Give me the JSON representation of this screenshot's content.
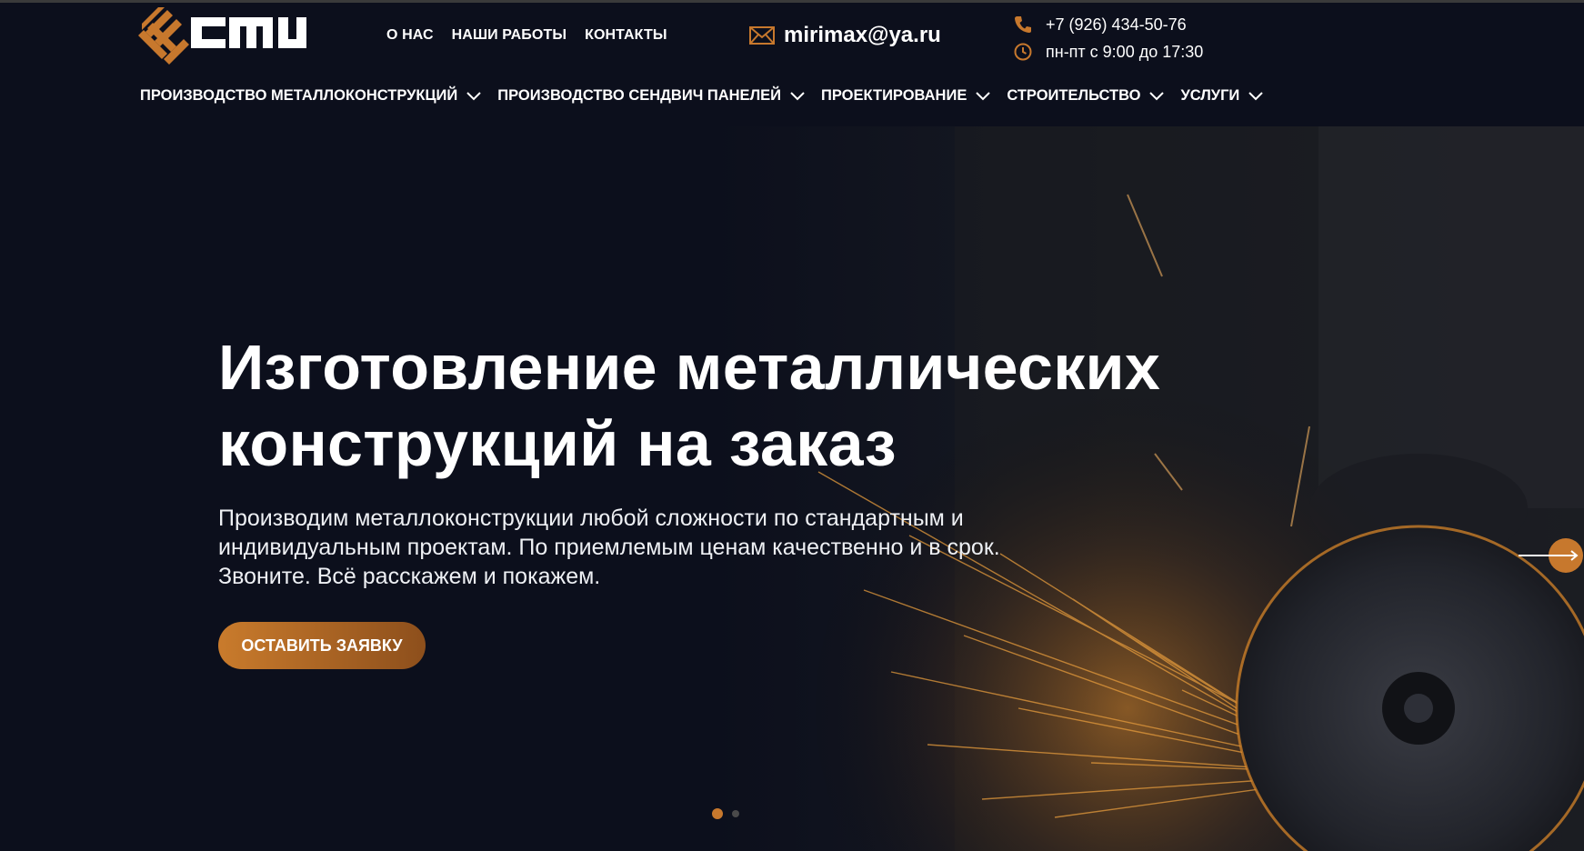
{
  "colors": {
    "background": "#0c0f1c",
    "accent": "#c7782d",
    "text": "#ffffff"
  },
  "header": {
    "logo_icon": "company-logo",
    "top_nav": [
      "О НАС",
      "НАШИ РАБОТЫ",
      "КОНТАКТЫ"
    ],
    "email": "mirimax@ya.ru",
    "email_icon": "envelope-icon",
    "phone": "+7 (926) 434-50-76",
    "phone_icon": "phone-icon",
    "hours": "пн-пт с 9:00 до 17:30",
    "hours_icon": "clock-icon"
  },
  "main_nav": [
    {
      "label": "ПРОИЗВОДСТВО МЕТАЛЛОКОНСТРУКЦИЙ"
    },
    {
      "label": "ПРОИЗВОДСТВО СЕНДВИЧ ПАНЕЛЕЙ"
    },
    {
      "label": "ПРОЕКТИРОВАНИЕ"
    },
    {
      "label": "СТРОИТЕЛЬСТВО"
    },
    {
      "label": "УСЛУГИ"
    }
  ],
  "hero": {
    "title_line1": "Изготовление металлических",
    "title_line2": "конструкций на заказ",
    "subtitle_line1": "Производим металлоконструкции любой сложности по стандартным и",
    "subtitle_line2": "индивидуальным проектам. По приемлемым ценам качественно и в срок.",
    "subtitle_line3": "Звоните. Всё расскажем и покажем.",
    "cta_label": "ОСТАВИТЬ ЗАЯВКУ",
    "next_icon": "arrow-right-icon",
    "slides_total": 2,
    "active_slide": 1
  }
}
